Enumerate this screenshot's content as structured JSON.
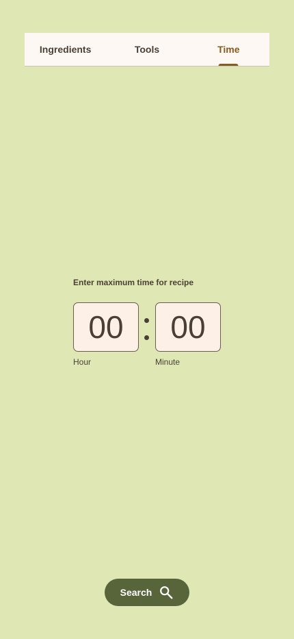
{
  "tabs": [
    {
      "label": "Ingredients",
      "active": false
    },
    {
      "label": "Tools",
      "active": false
    },
    {
      "label": "Time",
      "active": true
    }
  ],
  "time_entry": {
    "prompt": "Enter maximum time for recipe",
    "hour_value": "00",
    "minute_value": "00",
    "hour_label": "Hour",
    "minute_label": "Minute"
  },
  "search_button": {
    "label": "Search",
    "icon": "search-icon"
  },
  "colors": {
    "background": "#dfe8b5",
    "tab_bar": "#fdf8f4",
    "active_tab": "#8a5a1e",
    "time_box": "#fdf0e6",
    "button": "#58643a"
  }
}
